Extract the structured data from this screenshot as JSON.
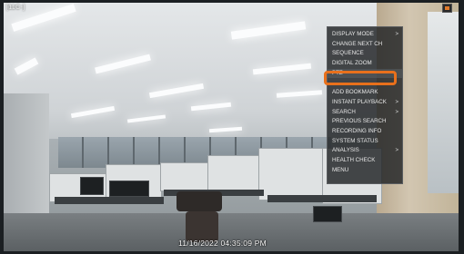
{
  "overlay": {
    "channel_label": "[11C-]",
    "timestamp": "11/16/2022 04:35:09 PM"
  },
  "context_menu": {
    "items": [
      {
        "label": "DISPLAY MODE",
        "submenu": true
      },
      {
        "label": "CHANGE NEXT CH",
        "submenu": false
      },
      {
        "label": "SEQUENCE",
        "submenu": false
      },
      {
        "label": "DIGITAL ZOOM",
        "submenu": false
      },
      {
        "label": "PTZ",
        "submenu": false,
        "highlighted": true
      },
      {
        "label": "",
        "submenu": false
      },
      {
        "label": "ADD BOOKMARK",
        "submenu": false
      },
      {
        "label": "INSTANT PLAYBACK",
        "submenu": true
      },
      {
        "label": "SEARCH",
        "submenu": true
      },
      {
        "label": "PREVIOUS SEARCH",
        "submenu": false
      },
      {
        "label": "RECORDING INFO",
        "submenu": false
      },
      {
        "label": "SYSTEM STATUS",
        "submenu": false
      },
      {
        "label": "ANALYSIS",
        "submenu": true
      },
      {
        "label": "HEALTH CHECK",
        "submenu": false
      },
      {
        "label": "MENU",
        "submenu": false
      }
    ],
    "arrow_glyph": ">"
  },
  "colors": {
    "highlight_box": "#e8701c",
    "menu_background": "#202224"
  },
  "icons": {
    "top_right": "alert-icon"
  }
}
